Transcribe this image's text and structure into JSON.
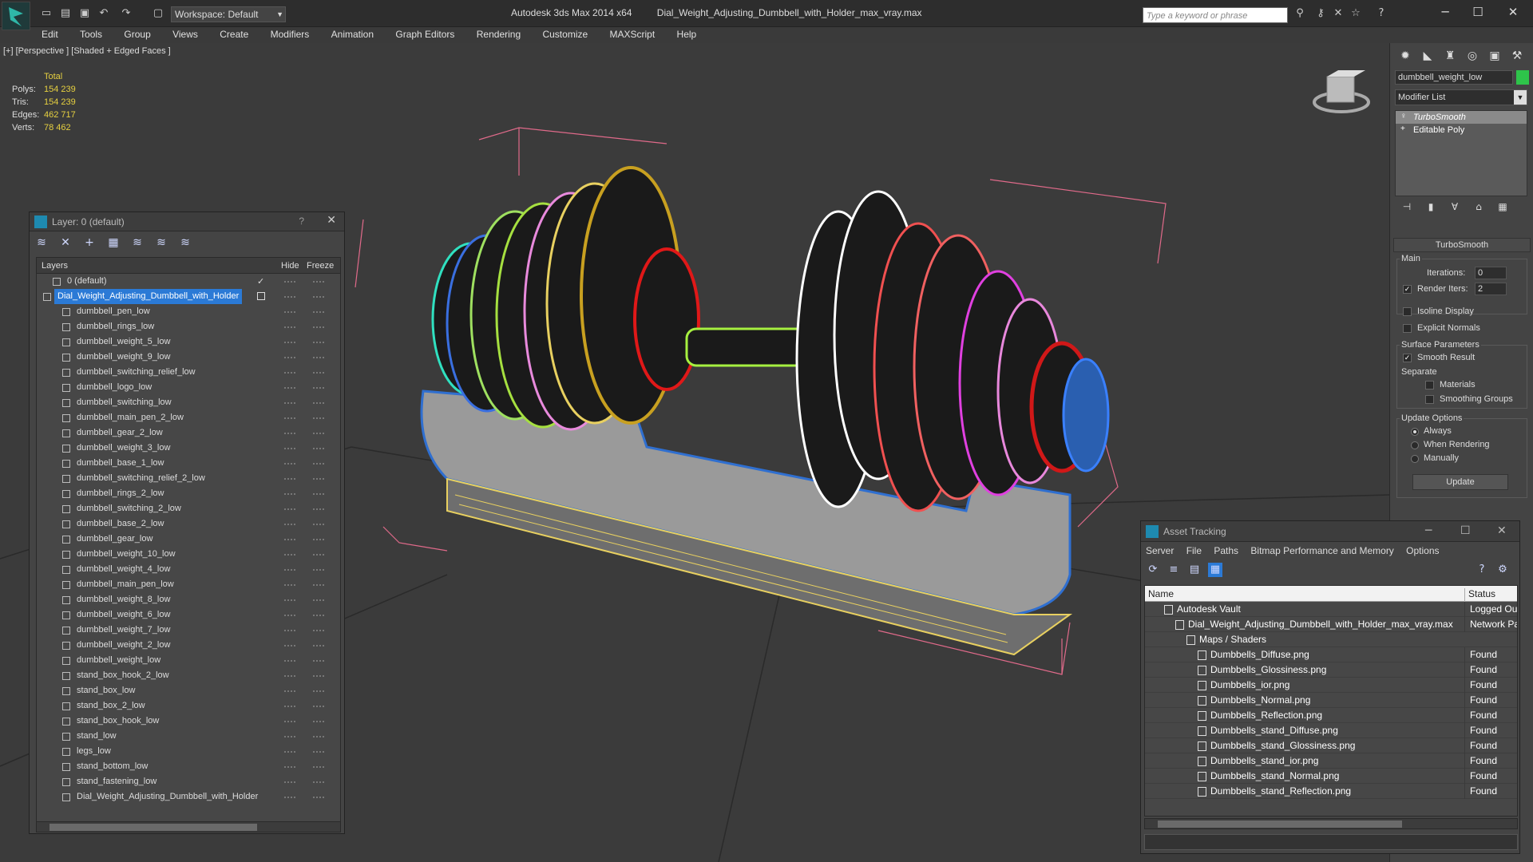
{
  "titlebar": {
    "workspace": "Workspace: Default",
    "app_name": "Autodesk 3ds Max  2014 x64",
    "file_name": "Dial_Weight_Adjusting_Dumbbell_with_Holder_max_vray.max",
    "search_placeholder": "Type a keyword or phrase"
  },
  "menu": [
    "Edit",
    "Tools",
    "Group",
    "Views",
    "Create",
    "Modifiers",
    "Animation",
    "Graph Editors",
    "Rendering",
    "Customize",
    "MAXScript",
    "Help"
  ],
  "viewport": {
    "label": "[+] [Perspective ] [Shaded + Edged Faces ]",
    "stats": {
      "header": "Total",
      "rows": [
        {
          "label": "Polys:",
          "value": "154 239"
        },
        {
          "label": "Tris:",
          "value": "154 239"
        },
        {
          "label": "Edges:",
          "value": "462 717"
        },
        {
          "label": "Verts:",
          "value": "78 462"
        }
      ]
    }
  },
  "layer_panel": {
    "title": "Layer: 0 (default)",
    "help": "?",
    "columns": {
      "layers": "Layers",
      "hide": "Hide",
      "freeze": "Freeze"
    },
    "rows": [
      {
        "name": "0 (default)",
        "level": 1,
        "checked": true
      },
      {
        "name": "Dial_Weight_Adjusting_Dumbbell_with_Holder",
        "level": 0,
        "selected": true
      },
      {
        "name": "dumbbell_pen_low",
        "level": 2
      },
      {
        "name": "dumbbell_rings_low",
        "level": 2
      },
      {
        "name": "dumbbell_weight_5_low",
        "level": 2
      },
      {
        "name": "dumbbell_weight_9_low",
        "level": 2
      },
      {
        "name": "dumbbell_switching_relief_low",
        "level": 2
      },
      {
        "name": "dumbbell_logo_low",
        "level": 2
      },
      {
        "name": "dumbbell_switching_low",
        "level": 2
      },
      {
        "name": "dumbbell_main_pen_2_low",
        "level": 2
      },
      {
        "name": "dumbbell_gear_2_low",
        "level": 2
      },
      {
        "name": "dumbbell_weight_3_low",
        "level": 2
      },
      {
        "name": "dumbbell_base_1_low",
        "level": 2
      },
      {
        "name": "dumbbell_switching_relief_2_low",
        "level": 2
      },
      {
        "name": "dumbbell_rings_2_low",
        "level": 2
      },
      {
        "name": "dumbbell_switching_2_low",
        "level": 2
      },
      {
        "name": "dumbbell_base_2_low",
        "level": 2
      },
      {
        "name": "dumbbell_gear_low",
        "level": 2
      },
      {
        "name": "dumbbell_weight_10_low",
        "level": 2
      },
      {
        "name": "dumbbell_weight_4_low",
        "level": 2
      },
      {
        "name": "dumbbell_main_pen_low",
        "level": 2
      },
      {
        "name": "dumbbell_weight_8_low",
        "level": 2
      },
      {
        "name": "dumbbell_weight_6_low",
        "level": 2
      },
      {
        "name": "dumbbell_weight_7_low",
        "level": 2
      },
      {
        "name": "dumbbell_weight_2_low",
        "level": 2
      },
      {
        "name": "dumbbell_weight_low",
        "level": 2
      },
      {
        "name": "stand_box_hook_2_low",
        "level": 2
      },
      {
        "name": "stand_box_low",
        "level": 2
      },
      {
        "name": "stand_box_2_low",
        "level": 2
      },
      {
        "name": "stand_box_hook_low",
        "level": 2
      },
      {
        "name": "stand_low",
        "level": 2
      },
      {
        "name": "legs_low",
        "level": 2
      },
      {
        "name": "stand_bottom_low",
        "level": 2
      },
      {
        "name": "stand_fastening_low",
        "level": 2
      },
      {
        "name": "Dial_Weight_Adjusting_Dumbbell_with_Holder",
        "level": 2
      }
    ]
  },
  "command_panel": {
    "object_name": "dumbbell_weight_low",
    "object_color": "#2ec44a",
    "modifier_list": "Modifier List",
    "stack": [
      {
        "label": "TurboSmooth",
        "selected": true
      },
      {
        "label": "Editable Poly",
        "selected": false
      }
    ],
    "rollout_title": "TurboSmooth",
    "main_group": "Main",
    "iterations_label": "Iterations:",
    "iterations_value": "0",
    "render_iters_label": "Render Iters:",
    "render_iters_value": "2",
    "isoline_display": "Isoline Display",
    "explicit_normals": "Explicit Normals",
    "surface_group": "Surface Parameters",
    "smooth_result": "Smooth Result",
    "separate_label": "Separate",
    "materials": "Materials",
    "smoothing_groups": "Smoothing Groups",
    "update_group": "Update Options",
    "always": "Always",
    "when_rendering": "When Rendering",
    "manually": "Manually",
    "update_button": "Update"
  },
  "asset_tracking": {
    "title": "Asset Tracking",
    "menu": [
      "Server",
      "File",
      "Paths",
      "Bitmap Performance and Memory",
      "Options"
    ],
    "columns": {
      "name": "Name",
      "status": "Status"
    },
    "rows": [
      {
        "name": "Autodesk Vault",
        "status": "Logged Out",
        "indent": 1
      },
      {
        "name": "Dial_Weight_Adjusting_Dumbbell_with_Holder_max_vray.max",
        "status": "Network Path",
        "indent": 2
      },
      {
        "name": "Maps / Shaders",
        "status": "",
        "indent": 3
      },
      {
        "name": "Dumbbells_Diffuse.png",
        "status": "Found",
        "indent": 4
      },
      {
        "name": "Dumbbells_Glossiness.png",
        "status": "Found",
        "indent": 4
      },
      {
        "name": "Dumbbells_ior.png",
        "status": "Found",
        "indent": 4
      },
      {
        "name": "Dumbbells_Normal.png",
        "status": "Found",
        "indent": 4
      },
      {
        "name": "Dumbbells_Reflection.png",
        "status": "Found",
        "indent": 4
      },
      {
        "name": "Dumbbells_stand_Diffuse.png",
        "status": "Found",
        "indent": 4
      },
      {
        "name": "Dumbbells_stand_Glossiness.png",
        "status": "Found",
        "indent": 4
      },
      {
        "name": "Dumbbells_stand_ior.png",
        "status": "Found",
        "indent": 4
      },
      {
        "name": "Dumbbells_stand_Normal.png",
        "status": "Found",
        "indent": 4
      },
      {
        "name": "Dumbbells_stand_Reflection.png",
        "status": "Found",
        "indent": 4
      }
    ]
  }
}
